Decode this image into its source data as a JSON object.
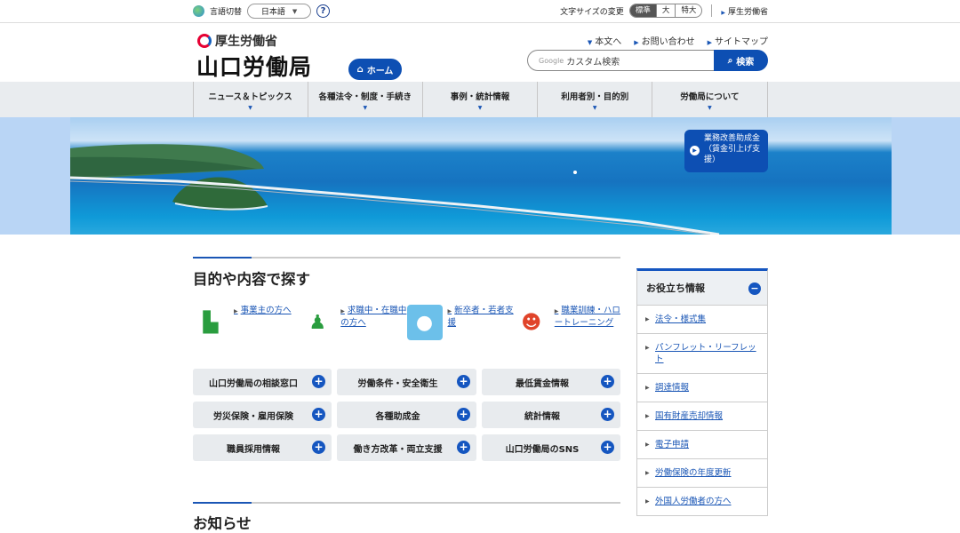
{
  "util": {
    "lang_label": "言語切替",
    "lang_value": "日本語",
    "help": "?",
    "fontsize_label": "文字サイズの変更",
    "fontsize_options": [
      "標準",
      "大",
      "特大"
    ],
    "mhlw_link": "厚生労働省"
  },
  "header": {
    "ministry": "厚生労働省",
    "bureau": "山口労働局",
    "home": "ホーム",
    "links": [
      "本文へ",
      "お問い合わせ",
      "サイトマップ"
    ],
    "search_placeholder": "カスタム検索",
    "search_google": "Google",
    "search_button": "検索"
  },
  "nav": [
    "ニュース＆トピックス",
    "各種法令・制度・手続き",
    "事例・統計情報",
    "利用者別・目的別",
    "労働局について"
  ],
  "hero": {
    "banner_line1": "業務改善助成金",
    "banner_line2": "（賃金引上げ支援）"
  },
  "main": {
    "purpose_title": "目的や内容で探す",
    "purposes": [
      {
        "label": "事業主の方へ",
        "icon": "building-person-icon"
      },
      {
        "label": "求職中・在職中の方へ",
        "icon": "meeting-icon"
      },
      {
        "label": "新卒者・若者支援",
        "icon": "polar-bear-icon"
      },
      {
        "label": "職業訓練・ハロートレーニング",
        "icon": "mascot-icon"
      }
    ],
    "grid": [
      "山口労働局の相談窓口",
      "労働条件・安全衛生",
      "最低賃金情報",
      "労災保険・雇用保険",
      "各種助成金",
      "統計情報",
      "職員採用情報",
      "働き方改革・両立支援",
      "山口労働局のSNS"
    ],
    "news_title": "お知らせ"
  },
  "side": {
    "title": "お役立ち情報",
    "items": [
      "法令・様式集",
      "パンフレット・リーフレット",
      "調達情報",
      "国有財産売却情報",
      "電子申請",
      "労働保険の年度更新",
      "外国人労働者の方へ"
    ]
  },
  "colors": {
    "primary": "#0d4fb3",
    "nav_bg": "#e9ecef",
    "link": "#1a56b5"
  }
}
